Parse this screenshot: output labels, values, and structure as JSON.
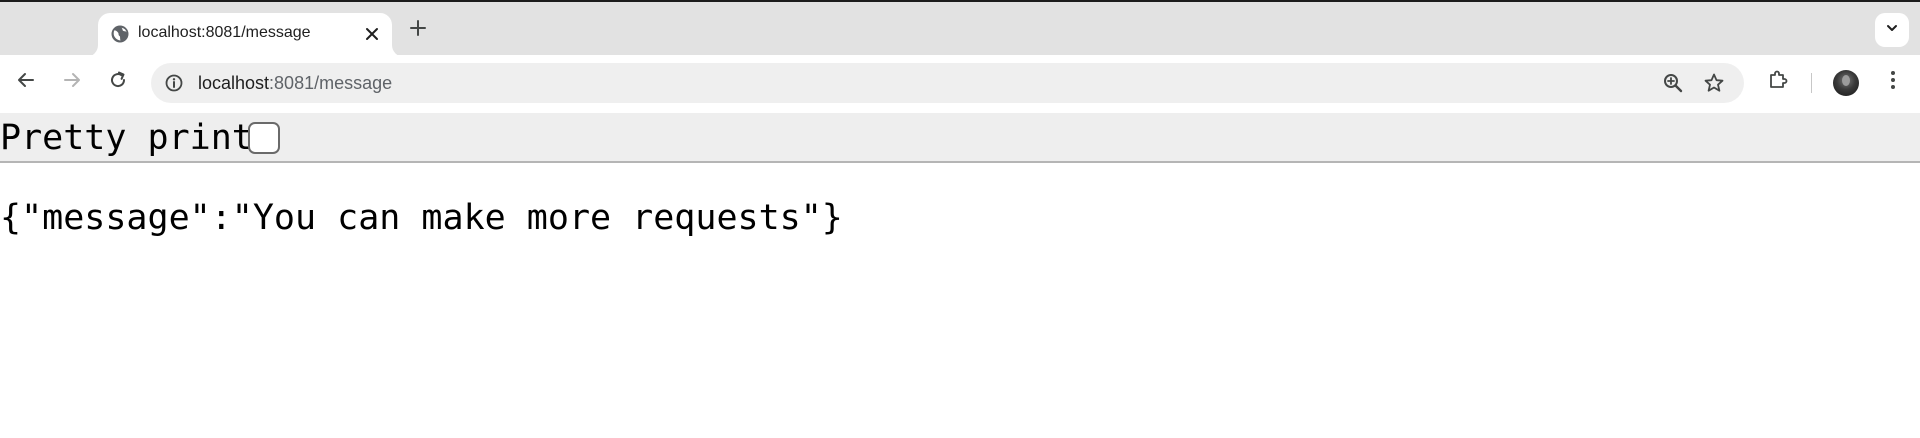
{
  "browser": {
    "tab": {
      "title": "localhost:8081/message",
      "favicon": "globe-icon",
      "close_icon": "close-icon"
    },
    "new_tab_icon": "plus-icon",
    "tab_search_icon": "chevron-down-icon",
    "toolbar": {
      "back_icon": "arrow-left-icon",
      "forward_icon": "arrow-right-icon",
      "reload_icon": "reload-icon",
      "extensions_icon": "puzzle-icon",
      "menu_icon": "kebab-menu-icon"
    },
    "omnibox": {
      "host": "localhost",
      "path": ":8081/message",
      "info_icon": "info-icon",
      "zoom_icon": "zoom-in-icon",
      "bookmark_icon": "star-icon"
    }
  },
  "page": {
    "pretty_print_label": "Pretty print",
    "pretty_print_checked": false,
    "json_text": "{\"message\":\"You can make more requests\"}"
  },
  "colors": {
    "tabstrip_bg": "#e2e2e2",
    "omnibox_bg": "#efefef",
    "pretty_print_bar_bg": "#eeeeee"
  }
}
